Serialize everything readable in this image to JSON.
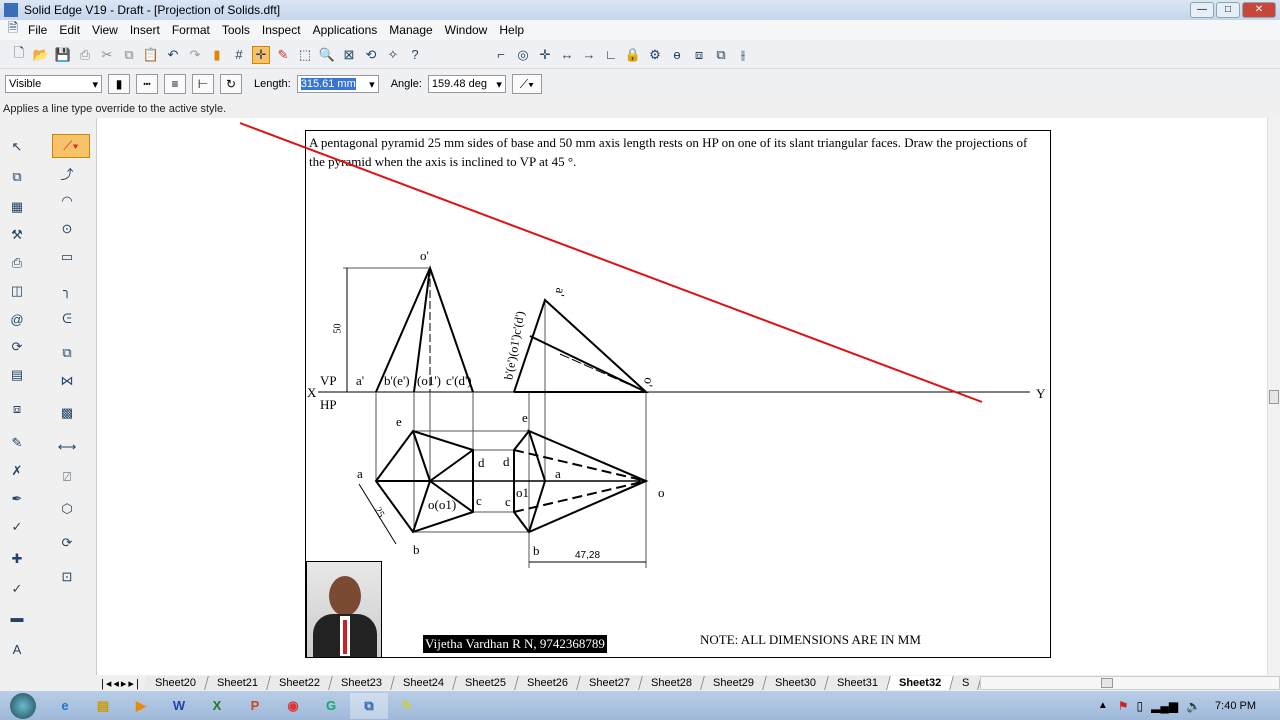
{
  "window": {
    "title": "Solid Edge V19 - Draft - [Projection of Solids.dft]",
    "min": "—",
    "max": "□",
    "close": "✕"
  },
  "menu": [
    "File",
    "Edit",
    "View",
    "Insert",
    "Format",
    "Tools",
    "Inspect",
    "Applications",
    "Manage",
    "Window",
    "Help"
  ],
  "ribbon": {
    "line_style": "Visible",
    "length_label": "Length:",
    "length_value": "315.61 mm",
    "angle_label": "Angle:",
    "angle_value": "159.48 deg"
  },
  "status": "Applies a line type override to the active style.",
  "drawing": {
    "problem": "A pentagonal pyramid 25 mm sides of base and 50 mm axis length rests on HP on one of its slant triangular faces. Draw the projections of the pyramid when the axis is inclined to VP at 45 °.",
    "labels": {
      "o_prime": "o'",
      "vp": "VP",
      "hp": "HP",
      "x": "X",
      "y": "Y",
      "a_prime": "a'",
      "be_prime": "b'(e')",
      "o1_prime": "(o1')",
      "cd_prime": "c'(d')",
      "dim50": "50",
      "e": "e",
      "a": "a",
      "d": "d",
      "c": "c",
      "b": "b",
      "oo1": "o(o1)",
      "dim25": "25",
      "e2": "e",
      "d2": "d",
      "c2": "c",
      "o1": "o1",
      "a2": "a",
      "b2": "b",
      "o2": "o",
      "dim4728": "47,28",
      "a2_prime": "a'",
      "o2_prime": "o'",
      "slant_labels": "b'(e')(o1')c'(d')"
    },
    "author": "Vijetha Vardhan R N, 9742368789",
    "note": "NOTE: ALL DIMENSIONS ARE IN MM",
    "annotation_color": "#e01010"
  },
  "sheets": [
    "Sheet20",
    "Sheet21",
    "Sheet22",
    "Sheet23",
    "Sheet24",
    "Sheet25",
    "Sheet26",
    "Sheet27",
    "Sheet28",
    "Sheet29",
    "Sheet30",
    "Sheet31",
    "Sheet32",
    "S"
  ],
  "active_sheet": "Sheet32",
  "taskbar": {
    "apps": [
      "start",
      "ie",
      "explorer",
      "media",
      "W",
      "X",
      "P",
      "chrome",
      "G",
      "solidedge",
      "paint"
    ],
    "time": "7:40 PM"
  }
}
